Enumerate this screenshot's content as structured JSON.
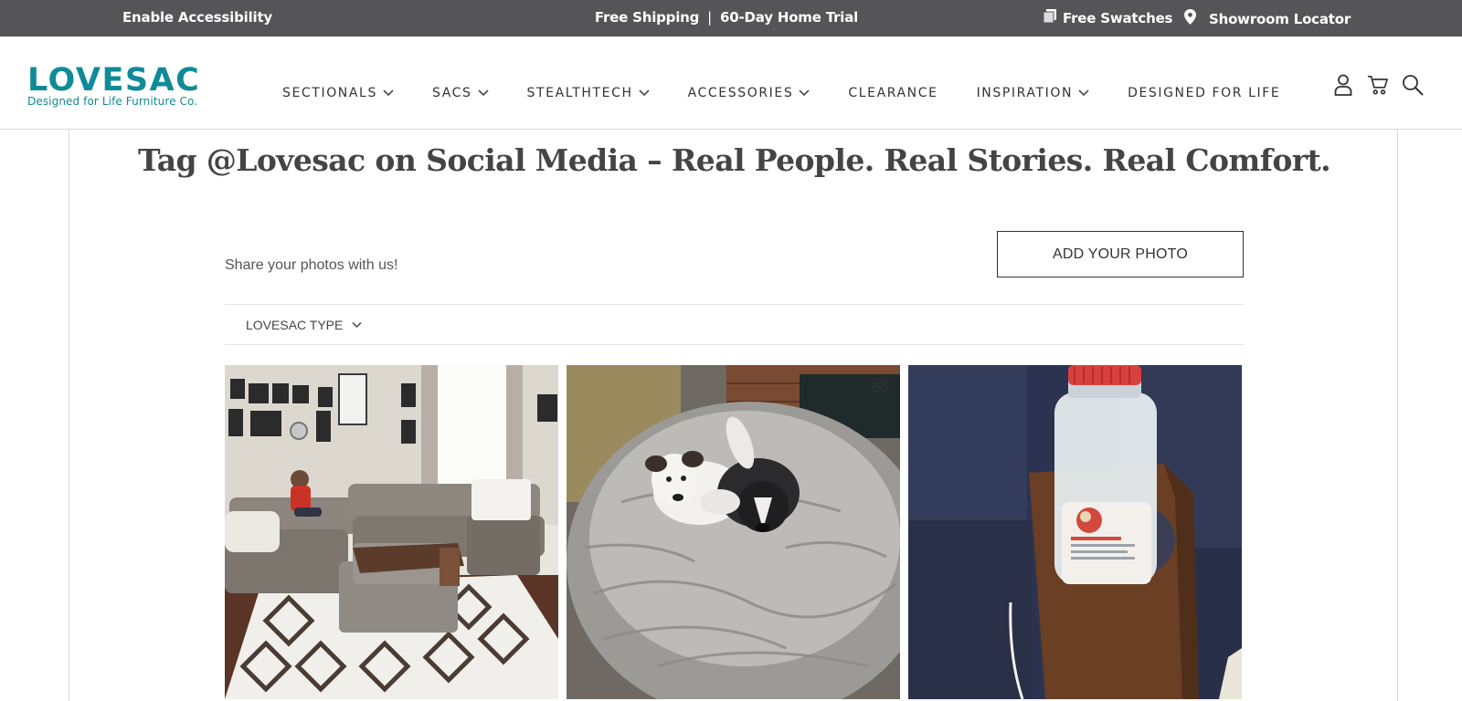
{
  "topbar": {
    "accessibility": "Enable Accessibility",
    "shipping": "Free Shipping",
    "separator": "|",
    "trial": "60-Day Home Trial",
    "swatches": "Free Swatches",
    "locator": "Showroom Locator"
  },
  "header": {
    "logo_word": "LOVESAC",
    "logo_tagline": "Designed for Life Furniture Co.",
    "nav": [
      {
        "label": "SECTIONALS",
        "dropdown": true
      },
      {
        "label": "SACS",
        "dropdown": true
      },
      {
        "label": "STEALTHTECH",
        "dropdown": true
      },
      {
        "label": "ACCESSORIES",
        "dropdown": true
      },
      {
        "label": "CLEARANCE",
        "dropdown": false
      },
      {
        "label": "INSPIRATION",
        "dropdown": true
      },
      {
        "label": "DESIGNED FOR LIFE",
        "dropdown": false
      }
    ],
    "icons": [
      "account-icon",
      "cart-icon",
      "search-icon"
    ]
  },
  "main": {
    "title": "Tag @Lovesac on Social Media – Real People. Real Stories. Real Comfort.",
    "share_text": "Share your photos with us!",
    "add_photo_label": "ADD YOUR PHOTO",
    "filter_label": "LOVESAC TYPE"
  },
  "colors": {
    "brand": "#0f8b97",
    "topbar": "#555557",
    "text": "#333333"
  }
}
